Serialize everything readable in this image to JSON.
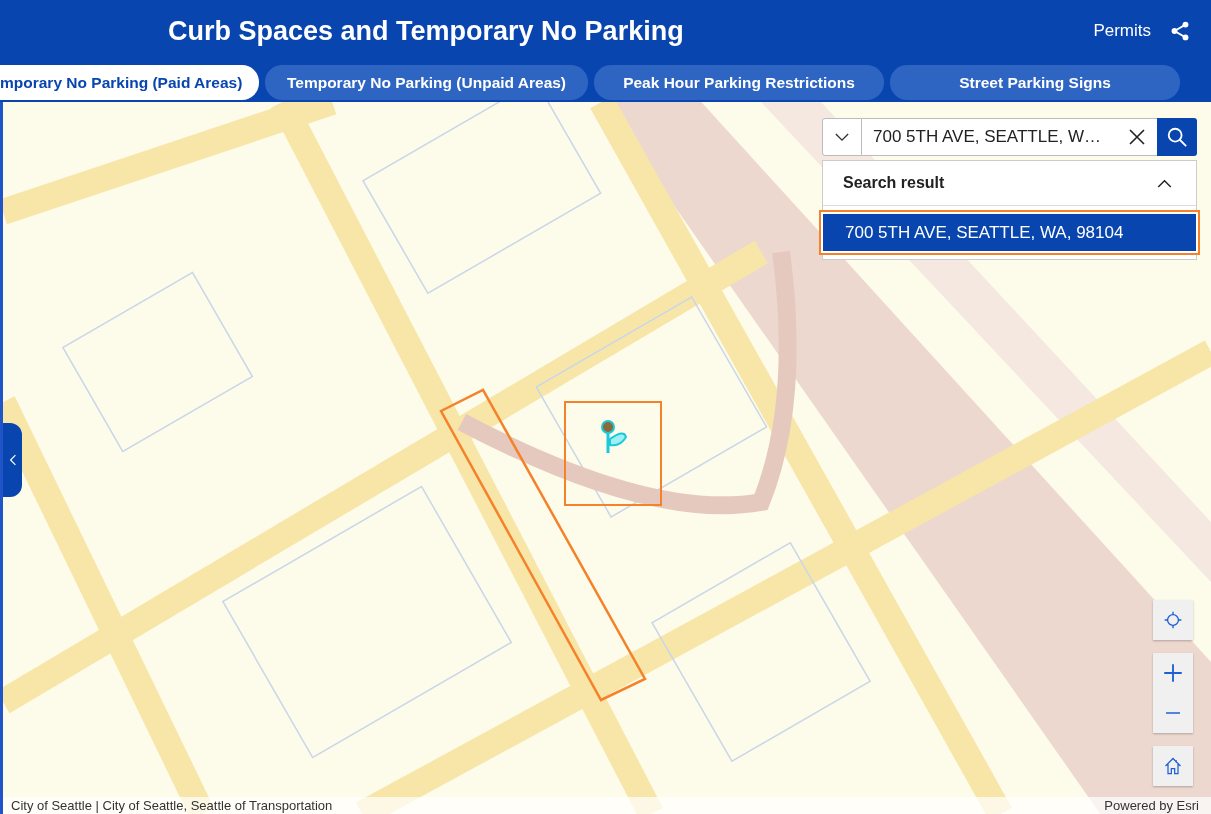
{
  "header": {
    "title": "Curb Spaces and Temporary No Parking",
    "link": "Permits"
  },
  "tabs": [
    {
      "label": "mporary No Parking (Paid Areas)",
      "selected": true
    },
    {
      "label": "Temporary No Parking (Unpaid Areas)",
      "selected": false
    },
    {
      "label": "Peak Hour Parking Restrictions",
      "selected": false
    },
    {
      "label": "Street Parking Signs",
      "selected": false
    }
  ],
  "search": {
    "value": "700 5TH AVE, SEATTLE, W…",
    "results_heading": "Search result",
    "results_expanded": true,
    "results": [
      {
        "label": "700 5TH AVE, SEATTLE, WA, 98104",
        "selected": true
      }
    ]
  },
  "attribution": {
    "sources": "City of Seattle | City of Seattle, Seattle of Transportation",
    "powered_by": "Powered by Esri"
  }
}
